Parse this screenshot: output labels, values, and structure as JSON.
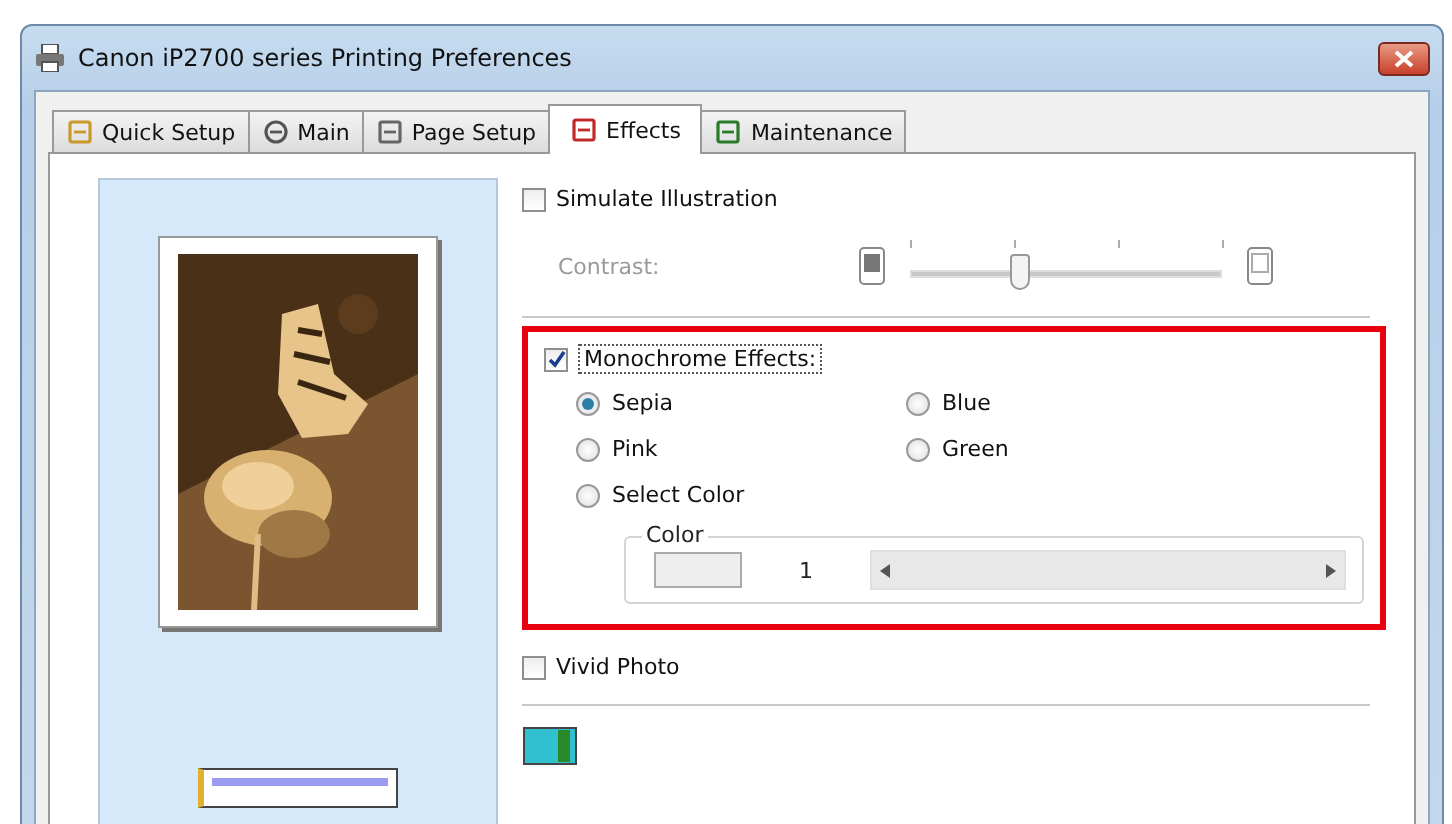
{
  "window": {
    "title": "Canon iP2700 series Printing Preferences"
  },
  "tabs": [
    {
      "label": "Quick Setup",
      "selected": false
    },
    {
      "label": "Main",
      "selected": false
    },
    {
      "label": "Page Setup",
      "selected": false
    },
    {
      "label": "Effects",
      "selected": true
    },
    {
      "label": "Maintenance",
      "selected": false
    }
  ],
  "simulate_illustration": {
    "label": "Simulate Illustration",
    "checked": false
  },
  "contrast": {
    "label": "Contrast:",
    "disabled": true,
    "level": 0.35
  },
  "monochrome_effects": {
    "label": "Monochrome Effects:",
    "checked": true,
    "highlighted": true,
    "options": [
      {
        "label": "Sepia",
        "selected": true
      },
      {
        "label": "Blue",
        "selected": false
      },
      {
        "label": "Pink",
        "selected": false
      },
      {
        "label": "Green",
        "selected": false
      },
      {
        "label": "Select Color",
        "selected": false
      }
    ],
    "color_group": {
      "label": "Color",
      "value": "1"
    }
  },
  "vivid_photo": {
    "label": "Vivid Photo",
    "checked": false
  }
}
